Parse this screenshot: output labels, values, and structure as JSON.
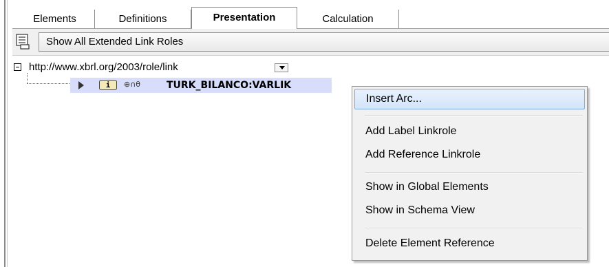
{
  "tabs": [
    {
      "label": "Elements",
      "active": false
    },
    {
      "label": "Definitions",
      "active": false
    },
    {
      "label": "Presentation",
      "active": true
    },
    {
      "label": "Calculation",
      "active": false
    }
  ],
  "toolbar": {
    "icon": "linkrole-list-icon",
    "extended_link_roles_label": "Show All Extended Link Roles"
  },
  "tree": {
    "root_role": "http://www.xbrl.org/2003/role/link",
    "element": {
      "icon": "info-icon",
      "icon_text": "i",
      "attr_glyphs": "⊕∩θ",
      "name": "TURK_BILANCO:VARLIK"
    }
  },
  "context_menu": {
    "items": [
      {
        "label": "Insert Arc...",
        "highlighted": true
      },
      {
        "label": "Add Label Linkrole"
      },
      {
        "label": "Add Reference Linkrole"
      },
      {
        "label": "Show in Global Elements"
      },
      {
        "label": "Show in Schema View"
      },
      {
        "label": "Delete Element Reference"
      }
    ]
  },
  "colors": {
    "menu_highlight": "#d3e5fa",
    "selected_row": "#d8ddfb",
    "menu_background": "#f1f1f1"
  }
}
